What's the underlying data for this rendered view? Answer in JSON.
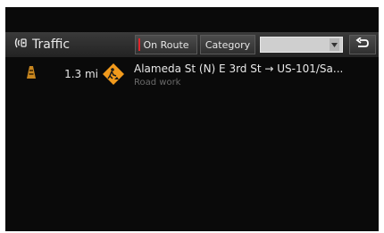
{
  "header": {
    "title": "Traffic",
    "on_route_label": "On Route",
    "category_label": "Category",
    "back_icon": "back-arrow-icon",
    "title_icon": "traffic-radio-icon"
  },
  "traffic_list": {
    "items": [
      {
        "distance": "1.3 mi",
        "title": "Alameda St (N) E 3rd St → US-101/Sa...",
        "subtitle": "Road work",
        "type_icon": "traffic-light-icon",
        "sign_icon": "road-work-sign-icon"
      }
    ]
  },
  "colors": {
    "background": "#0a0a0a",
    "header": "#2c2c2c",
    "accent_red": "#e0262c",
    "warning_orange": "#f29a1c",
    "text": "#e8e8e8",
    "subtext": "#6a6a6a"
  }
}
